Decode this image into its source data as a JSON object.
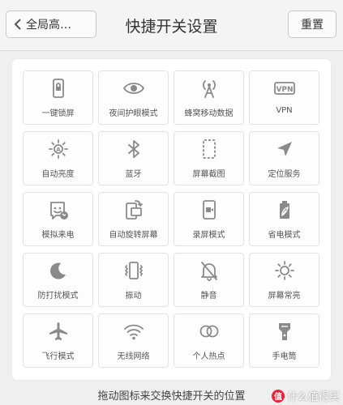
{
  "header": {
    "back_label": "全局高…",
    "title": "快捷开关设置",
    "reset_label": "重置"
  },
  "tiles": [
    {
      "label": "一键锁屏",
      "icon": "lock-screen-icon"
    },
    {
      "label": "夜间护眼模式",
      "icon": "eye-icon"
    },
    {
      "label": "蜂窝移动数据",
      "icon": "antenna-icon"
    },
    {
      "label": "VPN",
      "icon": "vpn-icon"
    },
    {
      "label": "自动亮度",
      "icon": "auto-brightness-icon"
    },
    {
      "label": "蓝牙",
      "icon": "bluetooth-icon"
    },
    {
      "label": "屏幕截图",
      "icon": "screenshot-icon"
    },
    {
      "label": "定位服务",
      "icon": "location-arrow-icon"
    },
    {
      "label": "模拟来电",
      "icon": "fake-call-icon"
    },
    {
      "label": "自动旋转屏幕",
      "icon": "rotate-screen-icon"
    },
    {
      "label": "录屏模式",
      "icon": "screen-record-icon"
    },
    {
      "label": "省电模式",
      "icon": "battery-saver-icon"
    },
    {
      "label": "防打扰模式",
      "icon": "moon-icon"
    },
    {
      "label": "振动",
      "icon": "vibrate-icon"
    },
    {
      "label": "静音",
      "icon": "mute-bell-icon"
    },
    {
      "label": "屏幕常亮",
      "icon": "sun-icon"
    },
    {
      "label": "飞行模式",
      "icon": "airplane-icon"
    },
    {
      "label": "无线网络",
      "icon": "wifi-icon"
    },
    {
      "label": "个人热点",
      "icon": "hotspot-icon"
    },
    {
      "label": "手电筒",
      "icon": "flashlight-icon"
    }
  ],
  "hint": "拖动图标来交换快捷开关的位置",
  "watermark": {
    "badge": "值",
    "text": "什么值得买"
  },
  "colors": {
    "icon": "#888888",
    "background": "#efefef",
    "panel": "#ffffff"
  }
}
